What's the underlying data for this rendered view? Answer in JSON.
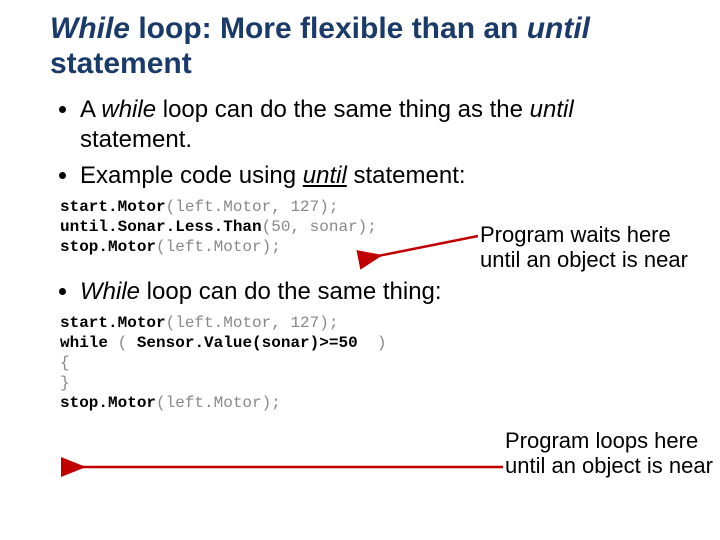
{
  "title": {
    "pre": "While",
    "mid": " loop: More flexible than an ",
    "post": "until",
    "tail": " statement"
  },
  "bullets": {
    "b1_a": "A ",
    "b1_while": "while",
    "b1_b": " loop can do the same thing as the ",
    "b1_until": "until",
    "b1_c": " statement.",
    "b2_a": "Example code using ",
    "b2_until": "until",
    "b2_b": " statement:",
    "b3_a": "While",
    "b3_b": " loop can do the same thing:"
  },
  "code1": {
    "l1_fn": "start.Motor",
    "l1_args": "(left.Motor, 127);",
    "l2_fn": "until.Sonar.Less.Than",
    "l2_args": "(50, sonar);",
    "l3_fn": "stop.Motor",
    "l3_args": "(left.Motor);"
  },
  "code2": {
    "l1_fn": "start.Motor",
    "l1_args": "(left.Motor, 127);",
    "l2_kw": "while",
    "l2_open": " ( ",
    "l2_expr": "Sensor.Value(sonar)>=50",
    "l2_close": "  )",
    "l3": "{",
    "l4": "}",
    "l5_fn": "stop.Motor",
    "l5_args": "(left.Motor);"
  },
  "notes": {
    "n1": "Program waits here until an object is near",
    "n2": "Program loops here until an object is near"
  }
}
